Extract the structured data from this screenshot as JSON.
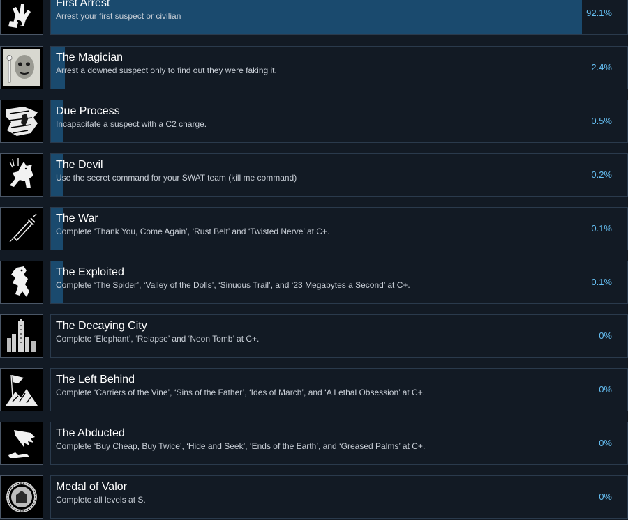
{
  "achievements": [
    {
      "icon": "hands-icon",
      "title": "First Arrest",
      "description": "Arrest your first suspect or civilian",
      "percent_label": "92.1%",
      "percent": 92.1
    },
    {
      "icon": "magician-face-icon",
      "title": "The Magician",
      "description": "Arrest a downed suspect only to find out they were faking it.",
      "percent_label": "2.4%",
      "percent": 2.4
    },
    {
      "icon": "explosion-figure-icon",
      "title": "Due Process",
      "description": "Incapacitate a suspect with a C2 charge.",
      "percent_label": "0.5%",
      "percent": 0.5
    },
    {
      "icon": "devil-icon",
      "title": "The Devil",
      "description": "Use the secret command for your SWAT team (kill me command)",
      "percent_label": "0.2%",
      "percent": 0.2
    },
    {
      "icon": "syringe-icon",
      "title": "The War",
      "description": "Complete ‘Thank You, Come Again’, ‘Rust Belt’ and ‘Twisted Nerve’ at C+.",
      "percent_label": "0.1%",
      "percent": 0.1
    },
    {
      "icon": "crouching-figure-icon",
      "title": "The Exploited",
      "description": "Complete ‘The Spider’, ‘Valley of the Dolls’, ‘Sinuous Trail’, and ‘23 Megabytes a Second’ at C+.",
      "percent_label": "0.1%",
      "percent": 0.1
    },
    {
      "icon": "city-skyline-icon",
      "title": "The Decaying City",
      "description": "Complete ‘Elephant’, ‘Relapse’ and ‘Neon Tomb’ at C+.",
      "percent_label": "0%",
      "percent": 0
    },
    {
      "icon": "flag-mountain-icon",
      "title": "The Left Behind",
      "description": "Complete ‘Carriers of the Vine’, ‘Sins of the Father’, ‘Ides of March’, and ‘A Lethal Obsession’ at C+.",
      "percent_label": "0%",
      "percent": 0
    },
    {
      "icon": "reaching-hand-icon",
      "title": "The Abducted",
      "description": "Complete ‘Buy Cheap, Buy Twice’, ‘Hide and Seek’, ‘Ends of the Earth’, and ‘Greased Palms’ at C+.",
      "percent_label": "0%",
      "percent": 0
    },
    {
      "icon": "medal-seal-icon",
      "title": "Medal of Valor",
      "description": "Complete all levels at S.",
      "percent_label": "0%",
      "percent": 0
    }
  ]
}
